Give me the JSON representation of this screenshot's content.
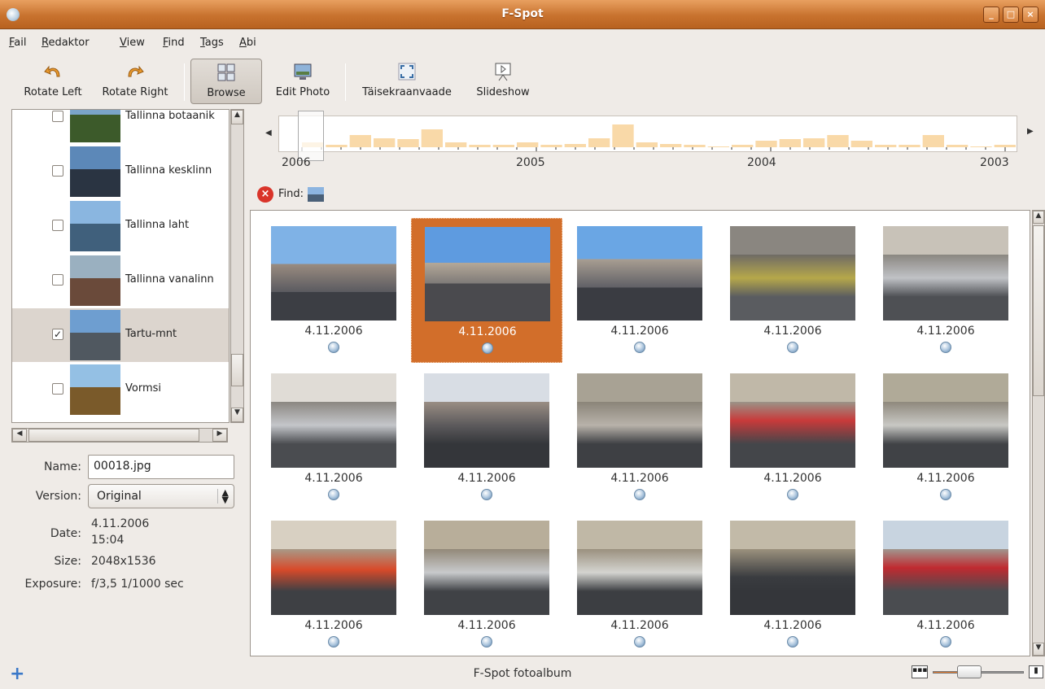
{
  "window": {
    "title": "F-Spot"
  },
  "menu": [
    "Fail",
    "Redaktor",
    "View",
    "Find",
    "Tags",
    "Abi"
  ],
  "toolbar": {
    "rotate_left": "Rotate Left",
    "rotate_right": "Rotate Right",
    "browse": "Browse",
    "edit_photo": "Edit Photo",
    "fullscreen": "Täisekraanvaade",
    "slideshow": "Slideshow"
  },
  "tags": [
    {
      "label": "Tallinna botaanik",
      "checked": false
    },
    {
      "label": "Tallinna kesklinn",
      "checked": false
    },
    {
      "label": "Tallinna laht",
      "checked": false
    },
    {
      "label": "Tallinna vanalinn",
      "checked": false
    },
    {
      "label": "Tartu-mnt",
      "checked": true,
      "check_mark": "✓"
    },
    {
      "label": "Vormsi",
      "checked": false
    }
  ],
  "info": {
    "name_label": "Name:",
    "name_value": "00018.jpg",
    "version_label": "Version:",
    "version_value": "Original",
    "date_label": "Date:",
    "date_line1": "4.11.2006",
    "date_line2": "15:04",
    "size_label": "Size:",
    "size_value": "2048x1536",
    "exposure_label": "Exposure:",
    "exposure_value": "f/3,5 1/1000 sec"
  },
  "timeline": {
    "years": [
      "2006",
      "2005",
      "2004",
      "2003"
    ],
    "bar_levels": [
      0.2,
      0.1,
      0.55,
      0.4,
      0.35,
      0.8,
      0.2,
      0.1,
      0.1,
      0.2,
      0.1,
      0.15,
      0.4,
      1.0,
      0.2,
      0.15,
      0.1,
      0.05,
      0.1,
      0.3,
      0.35,
      0.4,
      0.55,
      0.3,
      0.1,
      0.1,
      0.55,
      0.1,
      0.05,
      0.1
    ]
  },
  "find": {
    "label": "Find:"
  },
  "photos": [
    {
      "date": "4.11.2006"
    },
    {
      "date": "4.11.2006",
      "selected": true
    },
    {
      "date": "4.11.2006"
    },
    {
      "date": "4.11.2006"
    },
    {
      "date": "4.11.2006"
    },
    {
      "date": "4.11.2006"
    },
    {
      "date": "4.11.2006"
    },
    {
      "date": "4.11.2006"
    },
    {
      "date": "4.11.2006"
    },
    {
      "date": "4.11.2006"
    },
    {
      "date": "4.11.2006"
    },
    {
      "date": "4.11.2006"
    },
    {
      "date": "4.11.2006"
    },
    {
      "date": "4.11.2006"
    },
    {
      "date": "4.11.2006"
    }
  ],
  "status": {
    "text": "F-Spot fotoalbum"
  },
  "colors": {
    "accent": "#d26e2a",
    "timeline_bar": "#f9d9a8"
  },
  "zoom": {
    "level": 0.3
  }
}
